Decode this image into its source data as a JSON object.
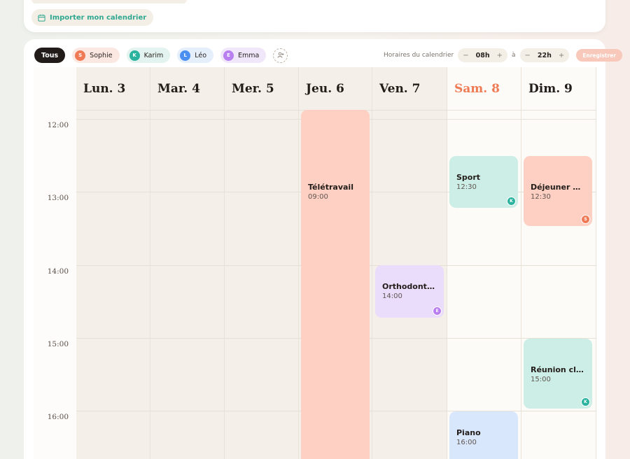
{
  "import_button": {
    "label": "Importer mon calendrier",
    "icon": "calendar-icon"
  },
  "filters": {
    "all_label": "Tous",
    "members": [
      {
        "initial": "S",
        "name": "Sophie",
        "color": "#f07a56",
        "bg": "#fbe8e2"
      },
      {
        "initial": "K",
        "name": "Karim",
        "color": "#2bb3a0",
        "bg": "#e3f3ef"
      },
      {
        "initial": "L",
        "name": "Léo",
        "color": "#4b8ff0",
        "bg": "#e5eefb"
      },
      {
        "initial": "E",
        "name": "Emma",
        "color": "#b97ff0",
        "bg": "#f1e7fb"
      }
    ],
    "add_member_icon": "add-person-icon"
  },
  "hours": {
    "label": "Horaires du calendrier",
    "start": "08h",
    "separator": "à",
    "end": "22h",
    "minus": "−",
    "plus": "+",
    "save_label": "Enregistrer"
  },
  "days": [
    {
      "label": "Lun. 3",
      "today": false
    },
    {
      "label": "Mar. 4",
      "today": false
    },
    {
      "label": "Mer. 5",
      "today": false
    },
    {
      "label": "Jeu. 6",
      "today": false
    },
    {
      "label": "Ven. 7",
      "today": false
    },
    {
      "label": "Sam. 8",
      "today": true
    },
    {
      "label": "Dim. 9",
      "today": false
    }
  ],
  "times": [
    "12:00",
    "13:00",
    "14:00",
    "15:00",
    "16:00"
  ],
  "events": [
    {
      "title": "Télétravail",
      "time": "09:00",
      "day": 3,
      "bg": "#fdd0c3",
      "member": ""
    },
    {
      "title": "Sport",
      "time": "12:30",
      "day": 5,
      "bg": "#cdeee6",
      "member": "K"
    },
    {
      "title": "Déjeuner ave...",
      "time": "12:30",
      "day": 6,
      "bg": "#fdd0c3",
      "member": "S"
    },
    {
      "title": "Orthodontiste",
      "time": "14:00",
      "day": 4,
      "bg": "#eadcfb",
      "member": "E"
    },
    {
      "title": "Réunion client",
      "time": "15:00",
      "day": 6,
      "bg": "#cdeee6",
      "member": "K"
    },
    {
      "title": "Piano",
      "time": "16:00",
      "day": 5,
      "bg": "#d9e7fd",
      "member": "L"
    }
  ]
}
